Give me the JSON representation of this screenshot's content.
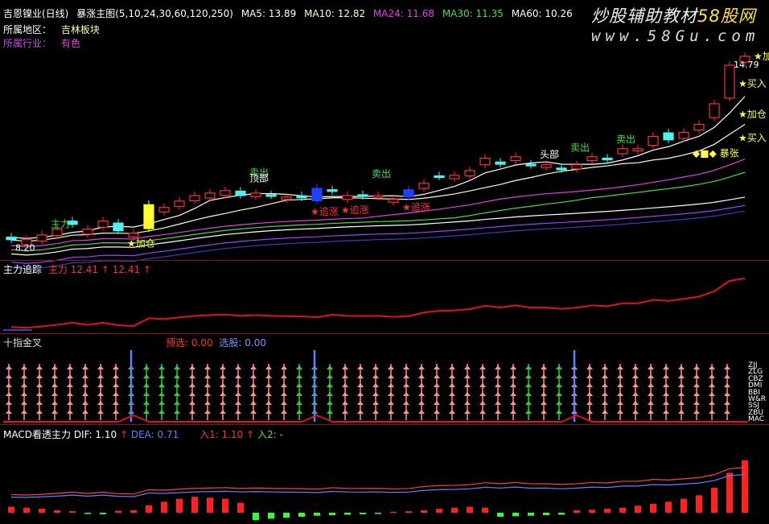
{
  "header": {
    "stock": "吉恩镍业(日线)",
    "indicator": "暴涨主图(5,10,24,30,60,120,250)",
    "ma5": "MA5: 13.89",
    "ma10": "MA10: 12.82",
    "ma24": "MA24: 11.68",
    "ma30": "MA30: 11.35",
    "ma60": "MA60: 10.26",
    "region_label": "所属地区：",
    "region_value": "吉林板块",
    "industry_label": "所属行业：",
    "industry_value": "有色"
  },
  "watermark": {
    "line1": "炒股辅助教材",
    "line1b": "58股网",
    "line2": "www.58Gu.com"
  },
  "colors": {
    "up": "#ff3030",
    "down": "#50f0f0",
    "blue": "#2040ff",
    "yellow": "#ffff30",
    "ma5": "#ffffff",
    "ma10": "#ffffc0",
    "ma24": "#e040e0",
    "ma30": "#40e040",
    "ma60": "#ffffff",
    "ma120": "#a040ff",
    "ma250": "#3040c0"
  },
  "main_chart": {
    "price_range": [
      8.0,
      15.4
    ],
    "candles": [
      [
        8.5,
        8.59,
        "down"
      ],
      [
        8.3,
        8.5,
        "up"
      ],
      [
        8.45,
        8.67,
        "up"
      ],
      [
        8.65,
        8.88,
        "up"
      ],
      [
        9.05,
        9.17,
        "down"
      ],
      [
        8.7,
        8.88,
        "up"
      ],
      [
        8.95,
        9.17,
        "up"
      ],
      [
        9.1,
        8.82,
        "down"
      ],
      [
        8.6,
        8.73,
        "up"
      ],
      [
        8.9,
        9.76,
        "yellow"
      ],
      [
        9.5,
        9.66,
        "up"
      ],
      [
        9.7,
        9.89,
        "up"
      ],
      [
        9.9,
        10.09,
        "up"
      ],
      [
        10.0,
        10.18,
        "up"
      ],
      [
        10.1,
        10.27,
        "up"
      ],
      [
        10.25,
        10.09,
        "down"
      ],
      [
        10.05,
        10.18,
        "up"
      ],
      [
        10.12,
        10.09,
        "down"
      ],
      [
        9.95,
        10.04,
        "up"
      ],
      [
        10.08,
        10.01,
        "down"
      ],
      [
        10.35,
        9.9,
        "blue"
      ],
      [
        10.3,
        10.24,
        "down"
      ],
      [
        9.95,
        10.09,
        "up"
      ],
      [
        10.12,
        10.06,
        "down"
      ],
      [
        10.05,
        10.09,
        "up"
      ],
      [
        9.85,
        9.95,
        "up"
      ],
      [
        10.3,
        10.05,
        "blue"
      ],
      [
        10.35,
        10.53,
        "up"
      ],
      [
        10.8,
        10.76,
        "down"
      ],
      [
        10.7,
        10.82,
        "up"
      ],
      [
        10.8,
        10.99,
        "up"
      ],
      [
        11.2,
        11.44,
        "up"
      ],
      [
        11.3,
        11.22,
        "down"
      ],
      [
        11.35,
        11.49,
        "up"
      ],
      [
        11.22,
        11.18,
        "down"
      ],
      [
        11.1,
        11.2,
        "up"
      ],
      [
        11.08,
        11.02,
        "down"
      ],
      [
        11.05,
        11.2,
        "up"
      ],
      [
        11.35,
        11.49,
        "up"
      ],
      [
        11.44,
        11.38,
        "down"
      ],
      [
        11.6,
        11.78,
        "up"
      ],
      [
        11.7,
        11.78,
        "up"
      ],
      [
        11.9,
        12.22,
        "up"
      ],
      [
        12.35,
        12.1,
        "down"
      ],
      [
        12.15,
        12.37,
        "up"
      ],
      [
        12.45,
        12.66,
        "up"
      ],
      [
        12.9,
        13.4,
        "up"
      ],
      [
        13.6,
        14.79,
        "up"
      ],
      [
        14.9,
        15.11,
        "up"
      ]
    ],
    "signals": [
      {
        "text": "主力",
        "i": 3,
        "p": 8.95,
        "color": "#40e040"
      },
      {
        "text": "卖出",
        "i": 16,
        "p": 10.8,
        "color": "#40e040"
      },
      {
        "text": "顶部",
        "i": 16,
        "p": 10.6,
        "color": "#ffffff"
      },
      {
        "text": "卖出",
        "i": 24,
        "p": 10.75,
        "color": "#40e040"
      },
      {
        "text": "卖出",
        "i": 37,
        "p": 11.7,
        "color": "#40e040"
      },
      {
        "text": "卖出",
        "i": 40,
        "p": 12.0,
        "color": "#40e040"
      },
      {
        "text": "头部",
        "i": 35,
        "p": 11.45,
        "color": "#ffffff"
      },
      {
        "text": "★加仓",
        "i": 8,
        "p": 8.25,
        "color": "#ffff40"
      },
      {
        "text": "★追涨",
        "i": 20,
        "p": 9.4,
        "color": "#ff3040"
      },
      {
        "text": "★追涨",
        "i": 22,
        "p": 9.45,
        "color": "#ff3040"
      },
      {
        "text": "★追涨",
        "i": 26,
        "p": 9.55,
        "color": "#ff3040"
      },
      {
        "text": "★买入",
        "i": 48,
        "p": 12.05,
        "color": "#ffff40"
      },
      {
        "text": "★加仓",
        "i": 48,
        "p": 12.9,
        "color": "#ffff40"
      },
      {
        "text": "★买入",
        "i": 48,
        "p": 14.0,
        "color": "#ffff40"
      },
      {
        "text": "★加仓",
        "i": 49,
        "p": 15.0,
        "color": "#ffff40"
      },
      {
        "text": "◆■◆ 暴张",
        "i": 45,
        "p": 11.5,
        "color": "#ffff40"
      }
    ],
    "price_labels": [
      {
        "text": "14.79",
        "i": 48,
        "p": 14.7
      },
      {
        "text": "8.20",
        "i": 1,
        "p": 8.1
      }
    ]
  },
  "panel2": {
    "title": "主力追踪",
    "label": "主力",
    "value1": "12.41",
    "value2": "12.41"
  },
  "panel3": {
    "title": "十指金叉",
    "label1": "预选:",
    "value1": "0.00",
    "label2": "选股:",
    "value2": "0.00",
    "columns": "ppppppppggggpppppppgggppppppppppppgpgppppppppppp",
    "blue_lines": [
      8,
      20,
      37
    ],
    "legend": [
      "ZJJ",
      "ZLG",
      "CBZ",
      "DMI",
      "BBI",
      "W&R",
      "SSJ",
      "ZBU",
      "MAC"
    ]
  },
  "panel4": {
    "title": "MACD看透主力",
    "dif": "DIF: 1.10",
    "dea": "DEA: 0.71",
    "in1": "入1: 1.10",
    "in2": "入2: -",
    "hist": [
      0.12,
      0.1,
      0.08,
      0.05,
      0.03,
      -0.02,
      -0.03,
      0.04,
      0.05,
      0.15,
      0.22,
      0.28,
      0.32,
      0.3,
      0.28,
      0.2,
      -0.15,
      -0.12,
      -0.1,
      -0.08,
      -0.06,
      -0.05,
      -0.04,
      -0.03,
      -0.02,
      0.02,
      0.03,
      0.05,
      0.08,
      0.1,
      0.12,
      0.1,
      -0.08,
      -0.07,
      -0.06,
      -0.05,
      -0.04,
      0.05,
      0.06,
      0.08,
      0.1,
      0.14,
      0.18,
      0.22,
      0.28,
      0.35,
      0.5,
      0.8,
      1.05
    ]
  }
}
